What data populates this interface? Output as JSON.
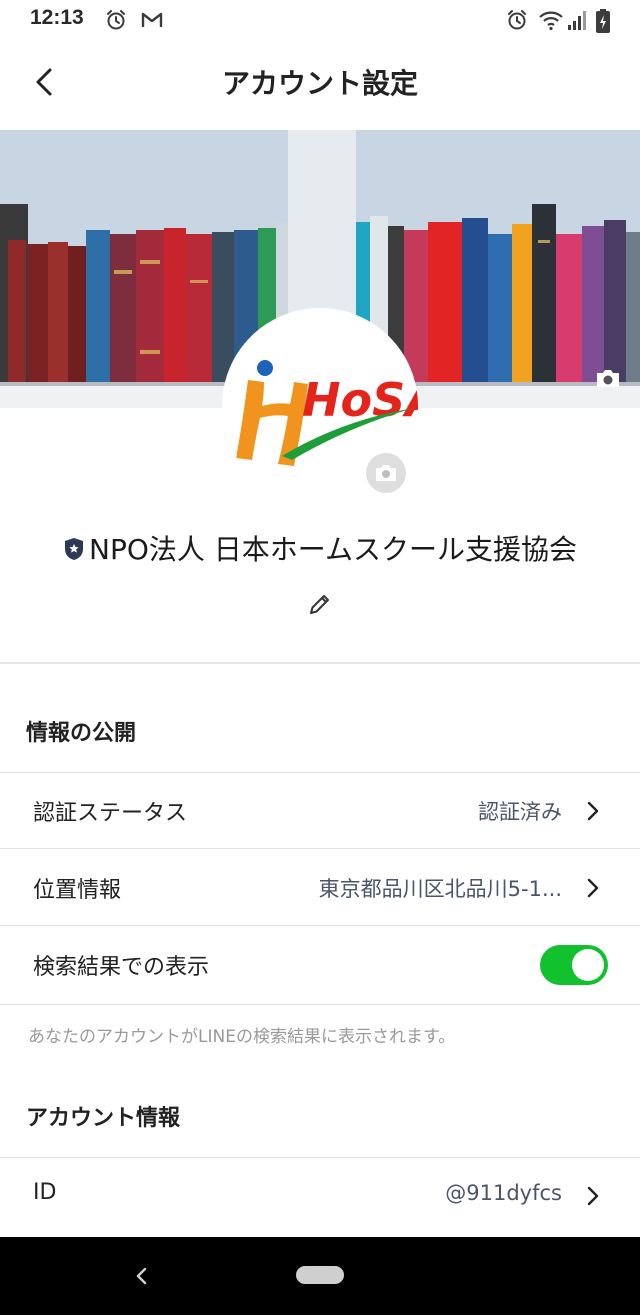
{
  "status_bar": {
    "time": "12:13",
    "left_icons": [
      "alarm-icon",
      "gmail-icon"
    ],
    "right_icons": [
      "alarm-icon",
      "wifi-icon",
      "signal-icon",
      "battery-icon"
    ]
  },
  "header": {
    "title": "アカウント設定",
    "back_icon": "back-arrow-icon"
  },
  "profile": {
    "logo_text": "HoSA",
    "name": "NPO法人 日本ホームスクール支援協会",
    "badge_icon": "shield-star-icon",
    "edit_icon": "pencil-icon"
  },
  "sections": {
    "public_info": {
      "title": "情報の公開",
      "rows": [
        {
          "label": "認証ステータス",
          "value": "認証済み"
        },
        {
          "label": "位置情報",
          "value": "東京都品川区北品川5-1..."
        },
        {
          "label": "検索結果での表示",
          "toggle_on": true
        }
      ],
      "note": "あなたのアカウントがLINEの検索結果に表示されます。"
    },
    "account_info": {
      "title": "アカウント情報",
      "rows": [
        {
          "label": "ID",
          "value": "@911dyfcs"
        }
      ]
    }
  },
  "colors": {
    "toggle_on": "#12c12e",
    "value_text": "#4a5568",
    "logo_orange": "#f0941e",
    "logo_red": "#e4231b",
    "logo_green": "#1e9e3a",
    "logo_blue": "#1d63b8"
  }
}
